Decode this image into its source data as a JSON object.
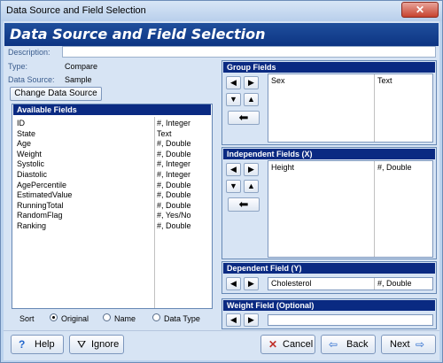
{
  "window": {
    "title": "Data Source and Field Selection",
    "close_glyph": "✕"
  },
  "banner": {
    "title": "Data Source and Field Selection"
  },
  "info": {
    "description_label": "Description:",
    "description_value": "",
    "type_label": "Type:",
    "type_value": "Compare",
    "data_source_label": "Data Source:",
    "data_source_value": "Sample"
  },
  "change_data_source": {
    "label": "Change Data Source"
  },
  "available_fields": {
    "header": "Available Fields",
    "rows": [
      {
        "name": "ID",
        "type": "#, Integer"
      },
      {
        "name": "State",
        "type": "Text"
      },
      {
        "name": "Age",
        "type": "#, Double"
      },
      {
        "name": "Weight",
        "type": "#, Double"
      },
      {
        "name": "Systolic",
        "type": "#, Integer"
      },
      {
        "name": "Diastolic",
        "type": "#, Integer"
      },
      {
        "name": "AgePercentile",
        "type": "#, Double"
      },
      {
        "name": "EstimatedValue",
        "type": "#, Double"
      },
      {
        "name": "RunningTotal",
        "type": "#, Double"
      },
      {
        "name": "RandomFlag",
        "type": "#, Yes/No"
      },
      {
        "name": "Ranking",
        "type": "#, Double"
      }
    ]
  },
  "sort": {
    "label": "Sort",
    "options": [
      "Original",
      "Name",
      "Data Type"
    ],
    "selected": "Original"
  },
  "group_fields": {
    "header": "Group Fields",
    "rows": [
      {
        "name": "Sex",
        "type": "Text"
      }
    ]
  },
  "independent_fields": {
    "header": "Independent Fields (X)",
    "rows": [
      {
        "name": "Height",
        "type": "#, Double"
      }
    ]
  },
  "dependent_field": {
    "header": "Dependent Field (Y)",
    "row": {
      "name": "Cholesterol",
      "type": "#, Double"
    }
  },
  "weight_field": {
    "header": "Weight Field (Optional)",
    "row": {
      "name": "",
      "type": ""
    }
  },
  "arrows": {
    "left": "◀",
    "right": "▶",
    "down": "▼",
    "up": "▲",
    "back": "⬅"
  },
  "bottom_buttons": {
    "help": "Help",
    "ignore": "Ignore",
    "cancel": "Cancel",
    "back": "Back",
    "next": "Next"
  },
  "icons": {
    "help": "?",
    "ignore": "⛛",
    "cancel": "✕",
    "back": "⇦",
    "next": "⇨"
  },
  "colors": {
    "banner": "#0d3483",
    "panel_header": "#0a2a82",
    "label": "#3a5c8d",
    "cancel_icon": "#c0302a",
    "nav_icon": "#2266cc"
  }
}
